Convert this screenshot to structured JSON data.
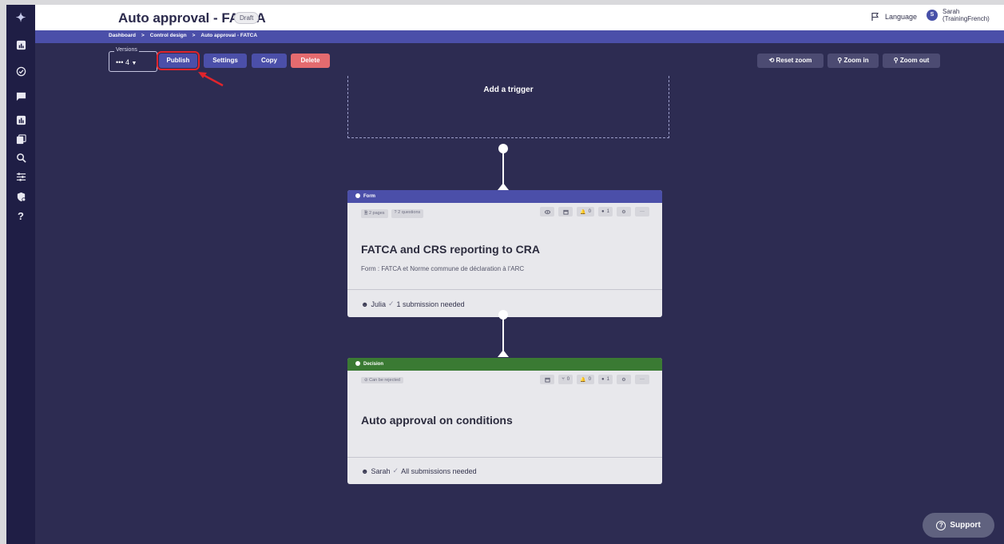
{
  "header": {
    "title": "Auto approval - FATCA",
    "badge": "Draft",
    "language_label": "Language",
    "user_initial": "S",
    "user_name": "Sarah",
    "user_role": "(TrainingFrench)"
  },
  "breadcrumb": [
    "Dashboard",
    "Control design",
    "Auto approval - FATCA"
  ],
  "toolbar": {
    "versions_label": "Versions",
    "versions_value": "4",
    "publish": "Publish",
    "settings": "Settings",
    "copy": "Copy",
    "delete": "Delete",
    "reset_zoom": "Reset zoom",
    "zoom_in": "Zoom in",
    "zoom_out": "Zoom out"
  },
  "sidebar": {
    "help": "?"
  },
  "canvas": {
    "trigger_label": "Add a trigger",
    "form_card": {
      "header": "Form",
      "tags": [
        "2 pages",
        "2 questions"
      ],
      "counters": [
        "0",
        "1"
      ],
      "title": "FATCA and CRS reporting to CRA",
      "subtitle": "Form : FATCA et Norme commune de déclaration à l'ARC",
      "assignee": "Julia",
      "requirement": "1 submission needed",
      "header_color": "#4b4fa9"
    },
    "decision_card": {
      "header": "Decision",
      "tags": [
        "Can be rejected"
      ],
      "counters": [
        "0",
        "0",
        "1"
      ],
      "title": "Auto approval on conditions",
      "assignee": "Sarah",
      "requirement": "All submissions needed",
      "header_color": "#3a7a33"
    }
  },
  "support_label": "Support",
  "colors": {
    "background": "#2d2c52",
    "primary": "#4b4fa9",
    "danger": "#e46b6f",
    "highlight": "#e0242c"
  }
}
